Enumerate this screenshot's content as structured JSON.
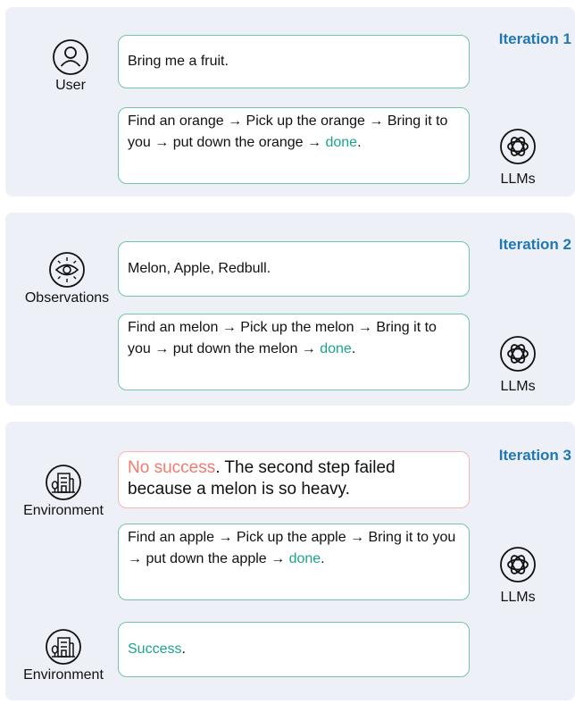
{
  "iteration1": {
    "title": "Iteration 1",
    "actor_label": "User",
    "prompt": "Bring me a fruit.",
    "plan_prefix": "Find an orange → Pick up the orange → Bring it to you → put down the orange → ",
    "plan_done": "done",
    "plan_suffix": ".",
    "llm_label": "LLMs"
  },
  "iteration2": {
    "title": "Iteration 2",
    "actor_label": "Observations",
    "prompt": "Melon, Apple, Redbull.",
    "plan_prefix": "Find an melon → Pick up the melon → Bring it to you → put down the melon → ",
    "plan_done": "done",
    "plan_suffix": ".",
    "llm_label": "LLMs"
  },
  "iteration3": {
    "title": "Iteration 3",
    "actor_label": "Environment",
    "feedback_status": "No success",
    "feedback_text": ". The second step failed because a melon is so heavy.",
    "plan_prefix": "Find an apple → Pick up the apple → Bring it to you → put down the apple → ",
    "plan_done": "done",
    "plan_suffix": ".",
    "llm_label": "LLMs",
    "final_actor_label": "Environment",
    "final_status": "Success",
    "final_suffix": "."
  },
  "colors": {
    "panel_bg": "#eef0f7",
    "iteration_title": "#1f77b4",
    "box_border": "#72c4ac",
    "success": "#1aa58c",
    "failure": "#f07a70",
    "failure_border": "#f2b7b0"
  },
  "icons": {
    "user": "user-icon",
    "observations": "eye-icon",
    "environment": "building-icon",
    "llm": "openai-logo-icon"
  }
}
